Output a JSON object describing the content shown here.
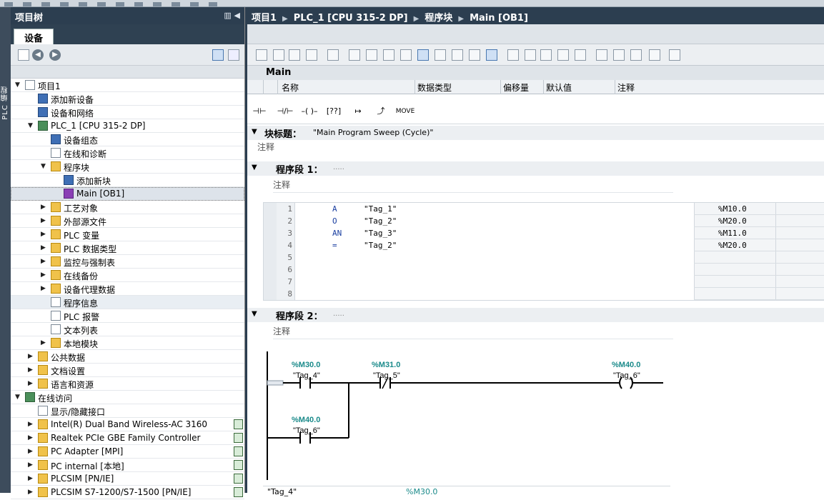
{
  "left_pane": {
    "title": "项目树",
    "tab": "设备",
    "vertical_tab": "PLC 编程",
    "tree": [
      {
        "label": "项目1",
        "level": 0,
        "expanded": true,
        "icon": "doc"
      },
      {
        "label": "添加新设备",
        "level": 1,
        "icon": "blue"
      },
      {
        "label": "设备和网络",
        "level": 1,
        "icon": "blue"
      },
      {
        "label": "PLC_1 [CPU 315-2 DP]",
        "level": 1,
        "expanded": true,
        "icon": "grn"
      },
      {
        "label": "设备组态",
        "level": 2,
        "icon": "blue"
      },
      {
        "label": "在线和诊断",
        "level": 2,
        "icon": "doc"
      },
      {
        "label": "程序块",
        "level": 2,
        "expanded": true,
        "icon": "folder"
      },
      {
        "label": "添加新块",
        "level": 3,
        "icon": "blue"
      },
      {
        "label": "Main [OB1]",
        "level": 3,
        "icon": "purple",
        "selected": true
      },
      {
        "label": "工艺对象",
        "level": 2,
        "collapsed": true,
        "icon": "folder"
      },
      {
        "label": "外部源文件",
        "level": 2,
        "collapsed": true,
        "icon": "folder"
      },
      {
        "label": "PLC 变量",
        "level": 2,
        "collapsed": true,
        "icon": "folder"
      },
      {
        "label": "PLC 数据类型",
        "level": 2,
        "collapsed": true,
        "icon": "folder"
      },
      {
        "label": "监控与强制表",
        "level": 2,
        "collapsed": true,
        "icon": "folder"
      },
      {
        "label": "在线备份",
        "level": 2,
        "collapsed": true,
        "icon": "folder"
      },
      {
        "label": "设备代理数据",
        "level": 2,
        "collapsed": true,
        "icon": "folder"
      },
      {
        "label": "程序信息",
        "level": 2,
        "icon": "doc",
        "highlight": true
      },
      {
        "label": "PLC 报警",
        "level": 2,
        "icon": "doc"
      },
      {
        "label": "文本列表",
        "level": 2,
        "icon": "doc"
      },
      {
        "label": "本地模块",
        "level": 2,
        "collapsed": true,
        "icon": "folder"
      },
      {
        "label": "公共数据",
        "level": 1,
        "collapsed": true,
        "icon": "folder"
      },
      {
        "label": "文档设置",
        "level": 1,
        "collapsed": true,
        "icon": "folder"
      },
      {
        "label": "语言和资源",
        "level": 1,
        "collapsed": true,
        "icon": "folder"
      },
      {
        "label": "在线访问",
        "level": 0,
        "expanded": true,
        "icon": "grn"
      },
      {
        "label": "显示/隐藏接口",
        "level": 1,
        "icon": "doc"
      },
      {
        "label": "Intel(R) Dual Band Wireless-AC 3160",
        "level": 1,
        "collapsed": true,
        "icon": "folder",
        "badge": true
      },
      {
        "label": "Realtek PCIe GBE Family Controller",
        "level": 1,
        "collapsed": true,
        "icon": "folder",
        "badge": true
      },
      {
        "label": "PC Adapter [MPI]",
        "level": 1,
        "collapsed": true,
        "icon": "folder",
        "badge": true
      },
      {
        "label": "PC internal [本地]",
        "level": 1,
        "collapsed": true,
        "icon": "folder",
        "badge": true
      },
      {
        "label": "PLCSIM [PN/IE]",
        "level": 1,
        "collapsed": true,
        "icon": "folder",
        "badge": true
      },
      {
        "label": "PLCSIM S7-1200/S7-1500 [PN/IE]",
        "level": 1,
        "collapsed": true,
        "icon": "folder",
        "badge": true
      }
    ]
  },
  "breadcrumb": [
    "项目1",
    "PLC_1 [CPU 315-2 DP]",
    "程序块",
    "Main [OB1]"
  ],
  "interface": {
    "title": "Main",
    "columns": [
      "名称",
      "数据类型",
      "偏移量",
      "默认值",
      "注释"
    ]
  },
  "ladder_toolbar": {
    "no_contact": "⊣⊢",
    "nc_contact": "⊣/⊢",
    "coil": "–( )–",
    "box": "[??]",
    "branch_open": "↦",
    "branch_close": "⤴",
    "move": "MOVE"
  },
  "block": {
    "title_label": "块标题：",
    "title_value": "\"Main Program Sweep (Cycle)\"",
    "comment": "注释"
  },
  "networks": [
    {
      "label": "程序段 1：",
      "dots": ".....",
      "comment": "注释",
      "stl": [
        {
          "line": "1",
          "op": "A",
          "tag": "\"Tag_1\"",
          "addr": "%M10.0"
        },
        {
          "line": "2",
          "op": "O",
          "tag": "\"Tag_2\"",
          "addr": "%M20.0"
        },
        {
          "line": "3",
          "op": "AN",
          "tag": "\"Tag_3\"",
          "addr": "%M11.0"
        },
        {
          "line": "4",
          "op": "=",
          "tag": "\"Tag_2\"",
          "addr": "%M20.0"
        },
        {
          "line": "5",
          "op": "",
          "tag": "",
          "addr": ""
        },
        {
          "line": "6",
          "op": "",
          "tag": "",
          "addr": ""
        },
        {
          "line": "7",
          "op": "",
          "tag": "",
          "addr": ""
        },
        {
          "line": "8",
          "op": "",
          "tag": "",
          "addr": ""
        }
      ]
    },
    {
      "label": "程序段 2：",
      "dots": ".....",
      "comment": "注释",
      "ladder": {
        "c1": {
          "addr": "%M30.0",
          "tag": "\"Tag_4\""
        },
        "c2": {
          "addr": "%M31.0",
          "tag": "\"Tag_5\""
        },
        "c3": {
          "addr": "%M40.0",
          "tag": "\"Tag_6\""
        },
        "coil": {
          "addr": "%M40.0",
          "tag": "\"Tag_6\""
        }
      },
      "footer": {
        "tag": "\"Tag_4\"",
        "addr": "%M30.0"
      }
    }
  ]
}
